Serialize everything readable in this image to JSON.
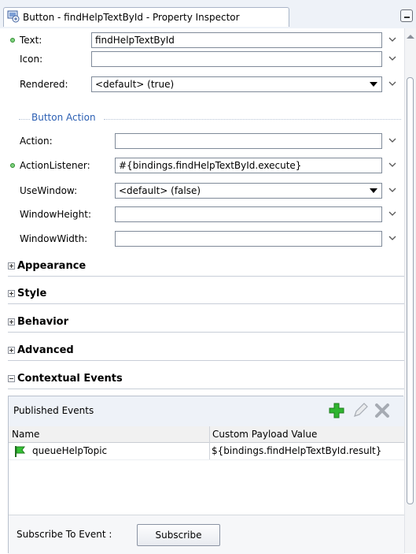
{
  "tab": {
    "title": "Button - findHelpTextById - Property Inspector",
    "icon": "button-component-icon"
  },
  "properties": {
    "text": {
      "label": "Text:",
      "value": "findHelpTextById",
      "modified": true
    },
    "icon": {
      "label": "Icon:",
      "value": ""
    },
    "rendered": {
      "label": "Rendered:",
      "value": "<default> (true)"
    }
  },
  "button_action": {
    "heading": "Button Action",
    "action": {
      "label": "Action:",
      "value": ""
    },
    "action_listener": {
      "label": "ActionListener:",
      "value": "#{bindings.findHelpTextById.execute}",
      "modified": true
    },
    "use_window": {
      "label": "UseWindow:",
      "value": "<default> (false)"
    },
    "window_height": {
      "label": "WindowHeight:",
      "value": ""
    },
    "window_width": {
      "label": "WindowWidth:",
      "value": ""
    }
  },
  "sections": [
    {
      "title": "Appearance",
      "expanded": false
    },
    {
      "title": "Style",
      "expanded": false
    },
    {
      "title": "Behavior",
      "expanded": false
    },
    {
      "title": "Advanced",
      "expanded": false
    },
    {
      "title": "Contextual Events",
      "expanded": true
    }
  ],
  "published_events": {
    "title": "Published Events",
    "columns": [
      "Name",
      "Custom Payload Value"
    ],
    "rows": [
      {
        "name": "queueHelpTopic",
        "payload": "${bindings.findHelpTextById.result}"
      }
    ],
    "subscribe_label": "Subscribe To Event :",
    "subscribe_button": "Subscribe"
  },
  "colors": {
    "modified_dot": "#7ed27e",
    "section_link": "#2b5fb3",
    "add_icon": "#2fb52f"
  }
}
